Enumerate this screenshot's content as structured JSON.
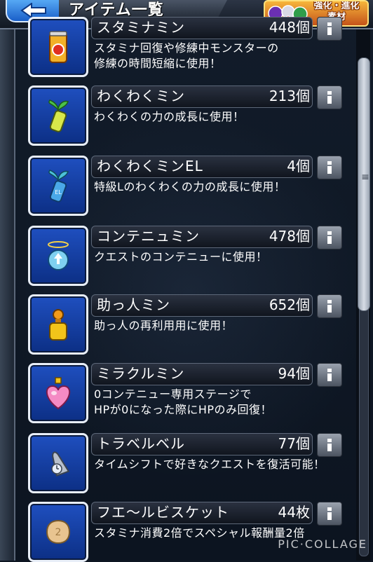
{
  "header": {
    "title": "アイテム一覧",
    "evo_badge_label_line1": "強化・進化",
    "evo_badge_label_line2": "素材"
  },
  "items": [
    {
      "name": "スタミナミン",
      "count": "448個",
      "desc": "スタミナ回復や修練中モンスターの\n修練の時間短縮に使用！",
      "icon": "stamina-can-icon"
    },
    {
      "name": "わくわくミン",
      "count": "213個",
      "desc": "わくわくの力の成長に使用！",
      "icon": "sprout-bottle-icon"
    },
    {
      "name": "わくわくミンEL",
      "count": "4個",
      "desc": "特級Lのわくわくの力の成長に使用！",
      "icon": "sprout-bottle-el-icon"
    },
    {
      "name": "コンテニュミン",
      "count": "478個",
      "desc": "クエストのコンテニューに使用！",
      "icon": "continue-potion-icon"
    },
    {
      "name": "助っ人ミン",
      "count": "652個",
      "desc": "助っ人の再利用用に使用！",
      "icon": "helper-bottle-icon"
    },
    {
      "name": "ミラクルミン",
      "count": "94個",
      "desc": "0コンテニュー専用ステージで\nHPが0になった際にHPのみ回復！",
      "icon": "miracle-heart-icon"
    },
    {
      "name": "トラベルベル",
      "count": "77個",
      "desc": "タイムシフトで好きなクエストを復活可能！",
      "icon": "travel-bell-icon"
    },
    {
      "name": "フエ～ルビスケット",
      "count": "44枚",
      "desc": "スタミナ消費2倍でスペシャル報酬量2倍",
      "icon": "biscuit-icon"
    }
  ],
  "watermark": "PIC·COLLAGE",
  "colors": {
    "icon_bg": "#1f4fbf",
    "back_button": "#3b8be6",
    "badge": "#e8892a"
  }
}
